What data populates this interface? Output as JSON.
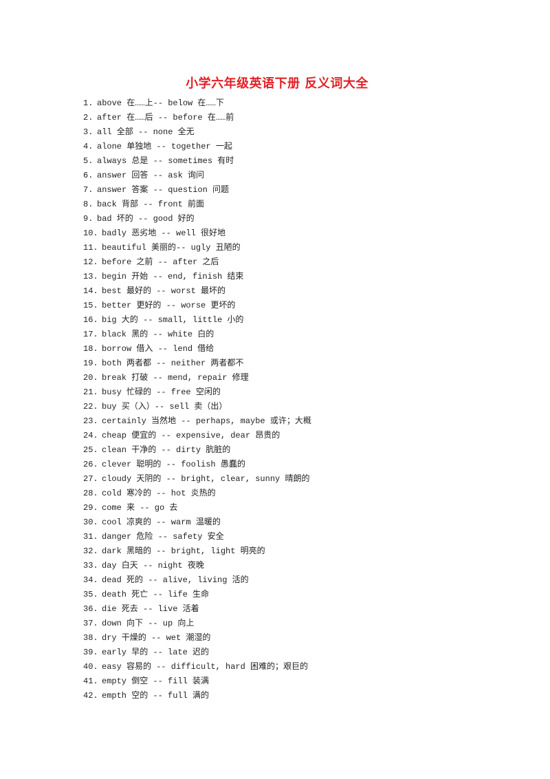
{
  "document": {
    "title": "小学六年级英语下册 反义词大全",
    "title_color": "#e41f25",
    "items": [
      {
        "num": "1.",
        "text": "above 在……上-- below 在……下"
      },
      {
        "num": "2.",
        "text": "after 在……后 -- before 在……前"
      },
      {
        "num": "3.",
        "text": "all 全部 -- none 全无"
      },
      {
        "num": "4.",
        "text": "alone 单独地 -- together 一起"
      },
      {
        "num": "5.",
        "text": "always 总是 -- sometimes 有时"
      },
      {
        "num": "6.",
        "text": "answer 回答 -- ask 询问"
      },
      {
        "num": "7.",
        "text": "answer 答案 -- question 问题"
      },
      {
        "num": "8.",
        "text": "back 背部 -- front 前面"
      },
      {
        "num": "9.",
        "text": "bad 坏的 -- good 好的"
      },
      {
        "num": "10.",
        "text": "badly 恶劣地 -- well 很好地"
      },
      {
        "num": "11.",
        "text": "beautiful 美丽的-- ugly 丑陋的"
      },
      {
        "num": "12.",
        "text": "before 之前 -- after 之后"
      },
      {
        "num": "13.",
        "text": "begin 开始 -- end, finish 结束"
      },
      {
        "num": "14.",
        "text": "best 最好的 -- worst 最坏的"
      },
      {
        "num": "15.",
        "text": "better 更好的 -- worse 更坏的"
      },
      {
        "num": "16.",
        "text": "big 大的 -- small, little 小的"
      },
      {
        "num": "17.",
        "text": "black 黑的 -- white 白的"
      },
      {
        "num": "18.",
        "text": "borrow 借入 -- lend 借给"
      },
      {
        "num": "19.",
        "text": "both 两者都 -- neither 两者都不"
      },
      {
        "num": "20.",
        "text": "break 打破 -- mend, repair 修理"
      },
      {
        "num": "21.",
        "text": "busy 忙碌的 -- free 空闲的"
      },
      {
        "num": "22.",
        "text": "buy 买（入）-- sell 卖（出）"
      },
      {
        "num": "23.",
        "text": "certainly 当然地 -- perhaps, maybe 或许；大概"
      },
      {
        "num": "24.",
        "text": "cheap 便宜的 -- expensive, dear 昂贵的"
      },
      {
        "num": "25.",
        "text": "clean 干净的 -- dirty 肮脏的"
      },
      {
        "num": "26.",
        "text": "clever 聪明的 -- foolish 愚蠢的"
      },
      {
        "num": "27.",
        "text": "cloudy 天阴的 -- bright, clear, sunny 晴朗的"
      },
      {
        "num": "28.",
        "text": "cold 寒冷的 -- hot 炎热的"
      },
      {
        "num": "29.",
        "text": "come 来 -- go 去"
      },
      {
        "num": "30.",
        "text": "cool 凉爽的 -- warm 温暖的"
      },
      {
        "num": "31.",
        "text": "danger 危险 -- safety 安全"
      },
      {
        "num": "32.",
        "text": "dark 黑暗的 -- bright, light 明亮的"
      },
      {
        "num": "33.",
        "text": "day 白天 -- night 夜晚"
      },
      {
        "num": "34.",
        "text": "dead 死的 -- alive, living 活的"
      },
      {
        "num": "35.",
        "text": "death 死亡 -- life 生命"
      },
      {
        "num": "36.",
        "text": "die 死去 -- live 活着"
      },
      {
        "num": "37.",
        "text": "down 向下 -- up 向上"
      },
      {
        "num": "38.",
        "text": "dry 干燥的 -- wet 潮湿的"
      },
      {
        "num": "39.",
        "text": "early 早的 -- late 迟的"
      },
      {
        "num": "40.",
        "text": "easy 容易的 -- difficult, hard 困难的；艰巨的"
      },
      {
        "num": "41.",
        "text": "empty 倒空 -- fill 装满"
      },
      {
        "num": "42.",
        "text": "empth 空的 -- full 满的"
      }
    ]
  }
}
